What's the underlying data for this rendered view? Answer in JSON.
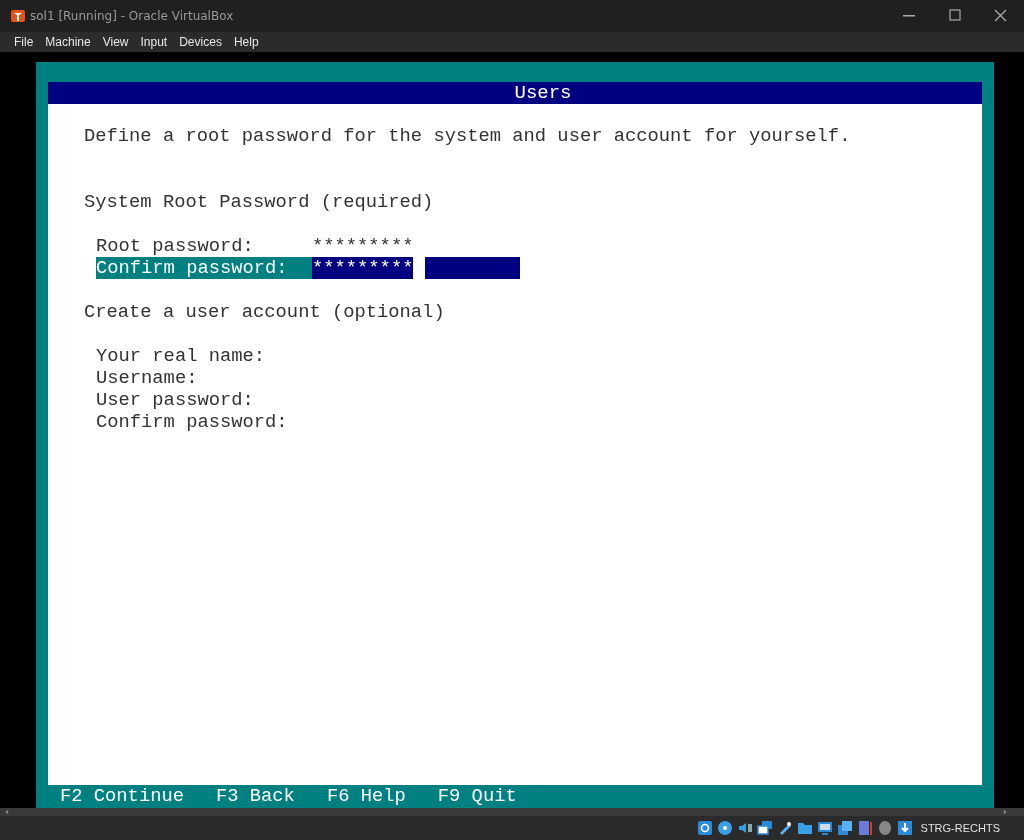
{
  "window": {
    "title": "sol1 [Running] - Oracle VirtualBox"
  },
  "menu": [
    "File",
    "Machine",
    "View",
    "Input",
    "Devices",
    "Help"
  ],
  "installer": {
    "title": "Users",
    "intro": "Define a root password for the system and user account for yourself.",
    "sections": [
      {
        "heading": "System Root Password (required)",
        "fields": [
          {
            "label": "Root password:",
            "value": "*********",
            "selected": false
          },
          {
            "label": "Confirm password:",
            "value": "*********",
            "selected": true
          }
        ]
      },
      {
        "heading": "Create a user account (optional)",
        "fields": [
          {
            "label": "Your real name:",
            "selected": false
          },
          {
            "label": "Username:",
            "selected": false
          },
          {
            "label": "User password:",
            "selected": false
          },
          {
            "label": "Confirm password:",
            "selected": false
          }
        ]
      }
    ],
    "keys": [
      "F2 Continue",
      "F3 Back",
      "F6 Help",
      "F9 Quit"
    ]
  },
  "status_bar": {
    "host_key": "STRG-RECHTS"
  }
}
